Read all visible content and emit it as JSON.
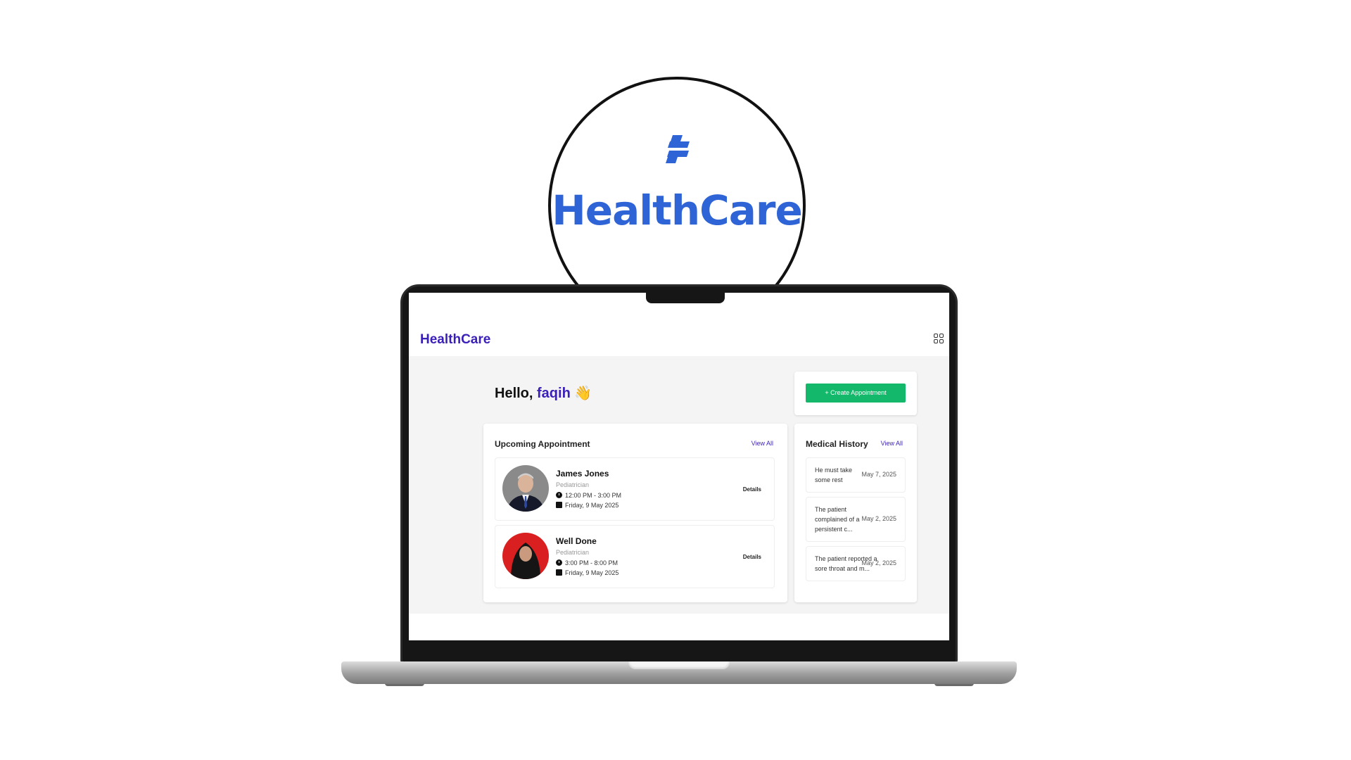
{
  "logo": {
    "wordmark": "HealthCare",
    "color": "#2f64d6"
  },
  "app": {
    "brand": "HealthCare",
    "brand_color": "#3a1fb8",
    "menu_icon": "apps-grid-icon"
  },
  "greeting": {
    "prefix": "Hello, ",
    "name": "faqih",
    "emoji": "👋"
  },
  "create_button": {
    "label": "+ Create Appointment",
    "color": "#14b86a"
  },
  "upcoming": {
    "title": "Upcoming Appointment",
    "view_all": "View All",
    "items": [
      {
        "name": "James Jones",
        "specialty": "Pediatrician",
        "time": "12:00 PM - 3:00 PM",
        "date": "Friday, 9 May 2025",
        "action": "Details"
      },
      {
        "name": "Well Done",
        "specialty": "Pediatrician",
        "time": "3:00 PM - 8:00 PM",
        "date": "Friday, 9 May 2025",
        "action": "Details"
      }
    ]
  },
  "history": {
    "title": "Medical History",
    "view_all": "View All",
    "items": [
      {
        "note": "He must take some rest",
        "date": "May 7, 2025"
      },
      {
        "note": "The patient complained of a persistent c...",
        "date": "May 2, 2025"
      },
      {
        "note": "The patient reported a sore throat and m...",
        "date": "May 2, 2025"
      }
    ]
  }
}
